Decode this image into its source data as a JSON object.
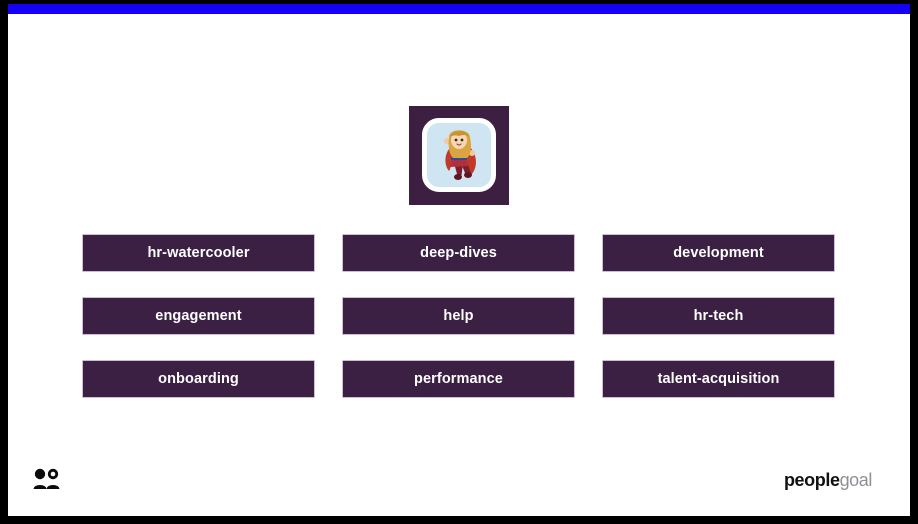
{
  "theme": {
    "frame_color": "#000000",
    "card_color": "#ffffff",
    "accent_bar_color": "#1400f5",
    "button_color": "#3b2044",
    "button_border_color": "#cdbfd3",
    "button_text_color": "#ffffff",
    "icon_tile_color": "#3d1f41",
    "icon_tile_inner_color": "#cfe6f2"
  },
  "header": {
    "accent_bar": "blue-accent-bar",
    "app_icon": {
      "name": "superhero-avatar-icon",
      "description": "supergirl cartoon avatar on rounded white-bordered tile"
    }
  },
  "main": {
    "channels": [
      {
        "label": "hr-watercooler"
      },
      {
        "label": "deep-dives"
      },
      {
        "label": "development"
      },
      {
        "label": "engagement"
      },
      {
        "label": "help"
      },
      {
        "label": "hr-tech"
      },
      {
        "label": "onboarding"
      },
      {
        "label": "performance"
      },
      {
        "label": "talent-acquisition"
      }
    ]
  },
  "footer": {
    "people_icon": "people-group-icon",
    "brand": {
      "part_bold": "people",
      "part_light": "goal"
    }
  }
}
